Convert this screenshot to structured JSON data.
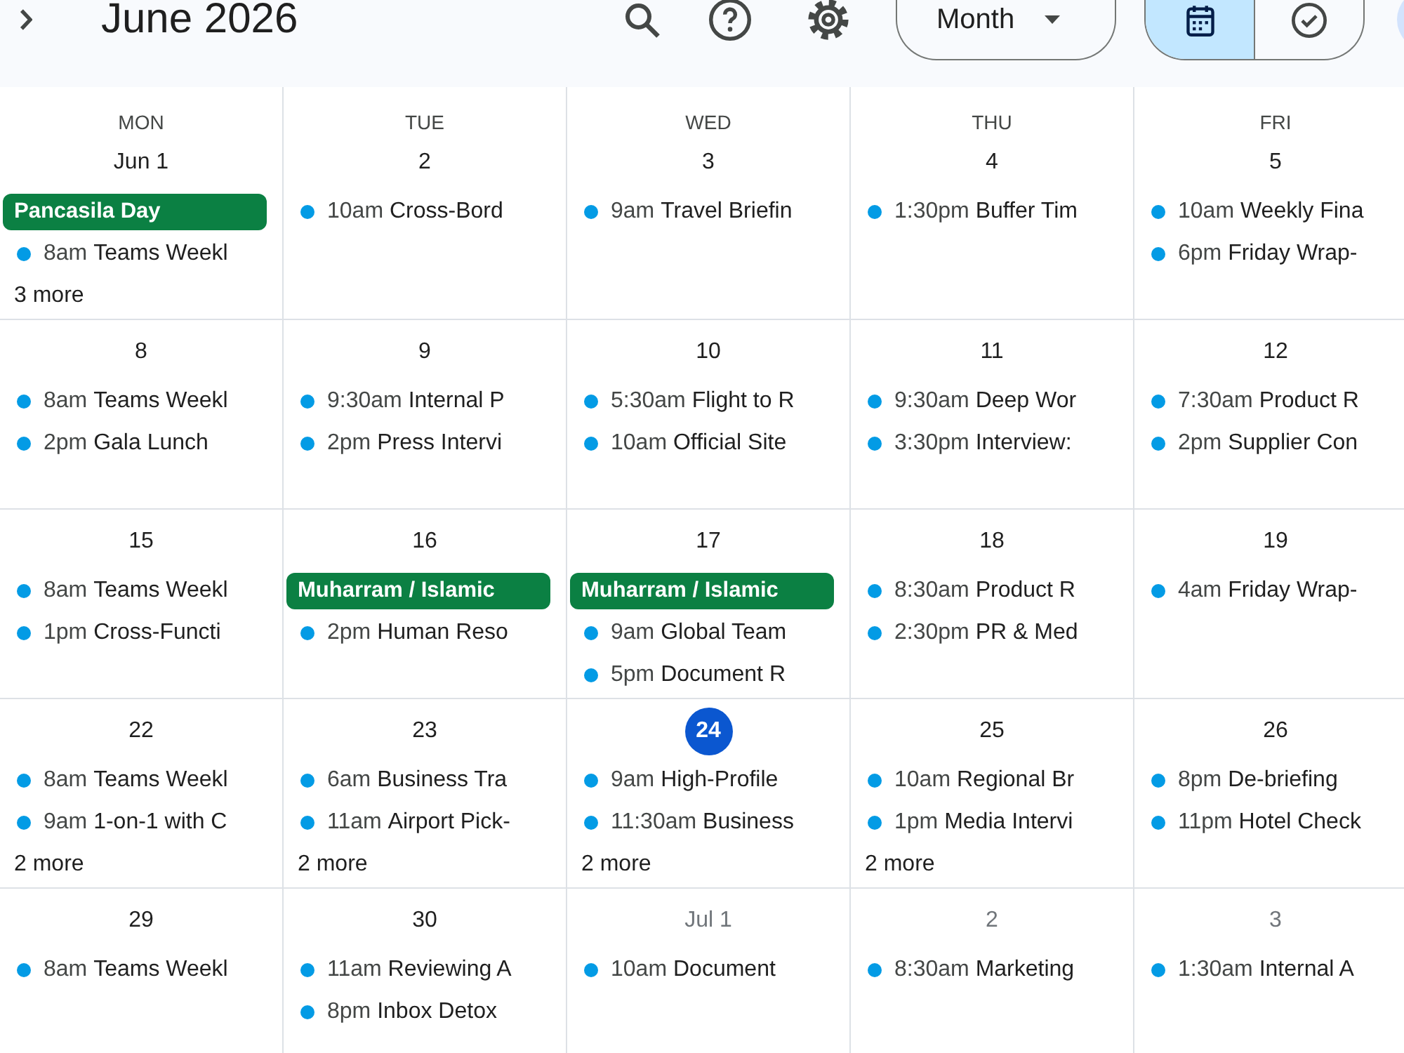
{
  "toolbar": {
    "title": "June 2026",
    "view_button": {
      "label": "Month"
    },
    "view_toggle": [
      {
        "kind": "calendar",
        "selected": true
      },
      {
        "kind": "tasks",
        "selected": false
      }
    ]
  },
  "weekdays": [
    "MON",
    "TUE",
    "WED",
    "THU",
    "FRI"
  ],
  "weeks": [
    {
      "days": [
        {
          "date": "Jun 1",
          "in_month": true,
          "today": false,
          "events": [
            {
              "kind": "all_day",
              "title": "Pancasila Day"
            },
            {
              "kind": "timed",
              "time": "8am",
              "title": "Teams Weekl"
            }
          ],
          "more": "3 more"
        },
        {
          "date": "2",
          "in_month": true,
          "today": false,
          "events": [
            {
              "kind": "timed",
              "time": "10am",
              "title": "Cross-Bord"
            }
          ]
        },
        {
          "date": "3",
          "in_month": true,
          "today": false,
          "events": [
            {
              "kind": "timed",
              "time": "9am",
              "title": "Travel Briefin"
            }
          ]
        },
        {
          "date": "4",
          "in_month": true,
          "today": false,
          "events": [
            {
              "kind": "timed",
              "time": "1:30pm",
              "title": "Buffer Tim"
            }
          ]
        },
        {
          "date": "5",
          "in_month": true,
          "today": false,
          "events": [
            {
              "kind": "timed",
              "time": "10am",
              "title": "Weekly Fina"
            },
            {
              "kind": "timed",
              "time": "6pm",
              "title": "Friday Wrap-"
            }
          ]
        }
      ]
    },
    {
      "days": [
        {
          "date": "8",
          "in_month": true,
          "today": false,
          "events": [
            {
              "kind": "timed",
              "time": "8am",
              "title": "Teams Weekl"
            },
            {
              "kind": "timed",
              "time": "2pm",
              "title": "Gala Lunch"
            }
          ]
        },
        {
          "date": "9",
          "in_month": true,
          "today": false,
          "events": [
            {
              "kind": "timed",
              "time": "9:30am",
              "title": "Internal P"
            },
            {
              "kind": "timed",
              "time": "2pm",
              "title": "Press Intervi"
            }
          ]
        },
        {
          "date": "10",
          "in_month": true,
          "today": false,
          "events": [
            {
              "kind": "timed",
              "time": "5:30am",
              "title": "Flight to R"
            },
            {
              "kind": "timed",
              "time": "10am",
              "title": "Official Site"
            }
          ]
        },
        {
          "date": "11",
          "in_month": true,
          "today": false,
          "events": [
            {
              "kind": "timed",
              "time": "9:30am",
              "title": "Deep Wor"
            },
            {
              "kind": "timed",
              "time": "3:30pm",
              "title": "Interview:"
            }
          ]
        },
        {
          "date": "12",
          "in_month": true,
          "today": false,
          "events": [
            {
              "kind": "timed",
              "time": "7:30am",
              "title": "Product R"
            },
            {
              "kind": "timed",
              "time": "2pm",
              "title": "Supplier Con"
            }
          ]
        }
      ]
    },
    {
      "days": [
        {
          "date": "15",
          "in_month": true,
          "today": false,
          "events": [
            {
              "kind": "timed",
              "time": "8am",
              "title": "Teams Weekl"
            },
            {
              "kind": "timed",
              "time": "1pm",
              "title": "Cross-Functi"
            }
          ]
        },
        {
          "date": "16",
          "in_month": true,
          "today": false,
          "events": [
            {
              "kind": "all_day",
              "title": "Muharram / Islamic"
            },
            {
              "kind": "timed",
              "time": "2pm",
              "title": "Human Reso"
            }
          ]
        },
        {
          "date": "17",
          "in_month": true,
          "today": false,
          "events": [
            {
              "kind": "all_day",
              "title": "Muharram / Islamic"
            },
            {
              "kind": "timed",
              "time": "9am",
              "title": "Global Team"
            },
            {
              "kind": "timed",
              "time": "5pm",
              "title": "Document R"
            }
          ]
        },
        {
          "date": "18",
          "in_month": true,
          "today": false,
          "events": [
            {
              "kind": "timed",
              "time": "8:30am",
              "title": "Product R"
            },
            {
              "kind": "timed",
              "time": "2:30pm",
              "title": "PR & Med"
            }
          ]
        },
        {
          "date": "19",
          "in_month": true,
          "today": false,
          "events": [
            {
              "kind": "timed",
              "time": "4am",
              "title": "Friday Wrap-"
            }
          ]
        }
      ]
    },
    {
      "days": [
        {
          "date": "22",
          "in_month": true,
          "today": false,
          "events": [
            {
              "kind": "timed",
              "time": "8am",
              "title": "Teams Weekl"
            },
            {
              "kind": "timed",
              "time": "9am",
              "title": "1-on-1 with C"
            }
          ],
          "more": "2 more"
        },
        {
          "date": "23",
          "in_month": true,
          "today": false,
          "events": [
            {
              "kind": "timed",
              "time": "6am",
              "title": "Business Tra"
            },
            {
              "kind": "timed",
              "time": "11am",
              "title": "Airport Pick-"
            }
          ],
          "more": "2 more"
        },
        {
          "date": "24",
          "in_month": true,
          "today": true,
          "events": [
            {
              "kind": "timed",
              "time": "9am",
              "title": "High-Profile"
            },
            {
              "kind": "timed",
              "time": "11:30am",
              "title": "Business"
            }
          ],
          "more": "2 more"
        },
        {
          "date": "25",
          "in_month": true,
          "today": false,
          "events": [
            {
              "kind": "timed",
              "time": "10am",
              "title": "Regional Br"
            },
            {
              "kind": "timed",
              "time": "1pm",
              "title": "Media Intervi"
            }
          ],
          "more": "2 more"
        },
        {
          "date": "26",
          "in_month": true,
          "today": false,
          "events": [
            {
              "kind": "timed",
              "time": "8pm",
              "title": "De-briefing"
            },
            {
              "kind": "timed",
              "time": "11pm",
              "title": "Hotel Check"
            }
          ]
        }
      ]
    },
    {
      "days": [
        {
          "date": "29",
          "in_month": true,
          "today": false,
          "events": [
            {
              "kind": "timed",
              "time": "8am",
              "title": "Teams Weekl"
            }
          ]
        },
        {
          "date": "30",
          "in_month": true,
          "today": false,
          "events": [
            {
              "kind": "timed",
              "time": "11am",
              "title": "Reviewing A"
            },
            {
              "kind": "timed",
              "time": "8pm",
              "title": "Inbox Detox"
            }
          ]
        },
        {
          "date": "Jul 1",
          "in_month": false,
          "today": false,
          "events": [
            {
              "kind": "timed",
              "time": "10am",
              "title": "Document"
            }
          ]
        },
        {
          "date": "2",
          "in_month": false,
          "today": false,
          "events": [
            {
              "kind": "timed",
              "time": "8:30am",
              "title": "Marketing"
            }
          ]
        },
        {
          "date": "3",
          "in_month": false,
          "today": false,
          "events": [
            {
              "kind": "timed",
              "time": "1:30am",
              "title": "Internal A"
            }
          ]
        }
      ]
    }
  ]
}
